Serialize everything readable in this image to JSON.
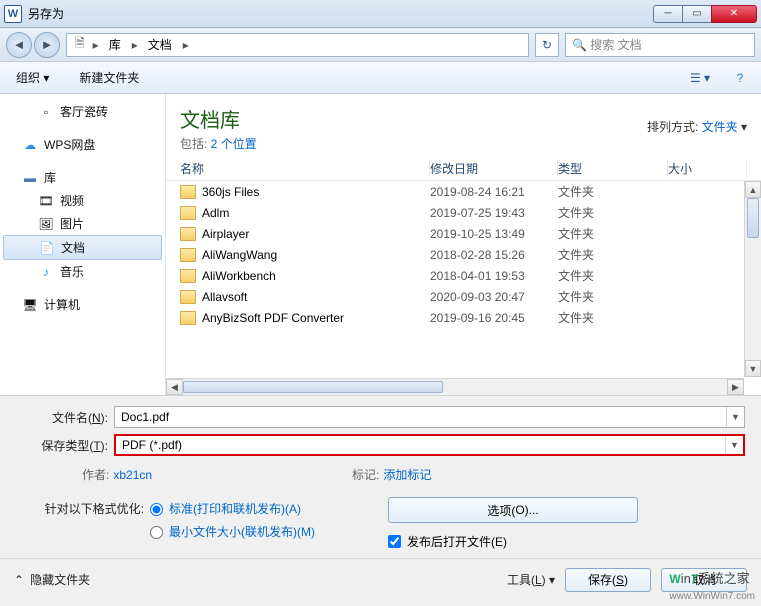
{
  "titlebar": {
    "title": "另存为"
  },
  "breadcrumb": {
    "root": "库",
    "current": "文档"
  },
  "search": {
    "placeholder": "搜索 文档"
  },
  "toolbar": {
    "organize": "组织",
    "new_folder": "新建文件夹"
  },
  "sidebar": {
    "tiles": "客厅瓷砖",
    "wps": "WPS网盘",
    "lib": "库",
    "video": "视频",
    "pictures": "图片",
    "documents": "文档",
    "music": "音乐",
    "computer": "计算机"
  },
  "main": {
    "lib_title": "文档库",
    "include_prefix": "包括: ",
    "include_count": "2 个位置",
    "sort_label": "排列方式:",
    "sort_value": "文件夹"
  },
  "columns": {
    "name": "名称",
    "date": "修改日期",
    "type": "类型",
    "size": "大小"
  },
  "files": [
    {
      "name": "360js Files",
      "date": "2019-08-24 16:21",
      "type": "文件夹"
    },
    {
      "name": "Adlm",
      "date": "2019-07-25 19:43",
      "type": "文件夹"
    },
    {
      "name": "Airplayer",
      "date": "2019-10-25 13:49",
      "type": "文件夹"
    },
    {
      "name": "AliWangWang",
      "date": "2018-02-28 15:26",
      "type": "文件夹"
    },
    {
      "name": "AliWorkbench",
      "date": "2018-04-01 19:53",
      "type": "文件夹"
    },
    {
      "name": "Allavsoft",
      "date": "2020-09-03 20:47",
      "type": "文件夹"
    },
    {
      "name": "AnyBizSoft PDF Converter",
      "date": "2019-09-16 20:45",
      "type": "文件夹"
    }
  ],
  "form": {
    "filename_label": "文件名(",
    "filename_u": "N",
    "filename_after": "):",
    "filename_value": "Doc1.pdf",
    "type_label": "保存类型(",
    "type_u": "T",
    "type_after": "):",
    "type_value": "PDF (*.pdf)",
    "author_label": "作者:",
    "author_value": "xb21cn",
    "tags_label": "标记:",
    "tags_value": "添加标记",
    "optimize_label": "针对以下格式优化:",
    "opt_standard": "标准(打印和联机发布)(",
    "opt_standard_u": "A",
    "opt_standard_after": ")",
    "opt_min": "最小文件大小(联机发布)(",
    "opt_min_u": "M",
    "opt_min_after": ")",
    "options_btn": "选项(",
    "options_u": "O",
    "options_after": ")...",
    "open_after": "发布后打开文件(",
    "open_after_u": "E",
    "open_after_after": ")"
  },
  "footer": {
    "hide": "隐藏文件夹",
    "tools": "工具(",
    "tools_u": "L",
    "tools_after": ")",
    "save": "保存(",
    "save_u": "S",
    "save_after": ")",
    "cancel": "取消"
  },
  "watermark": {
    "text": "Win7系统之家",
    "url": "www.WinWin7.com"
  }
}
